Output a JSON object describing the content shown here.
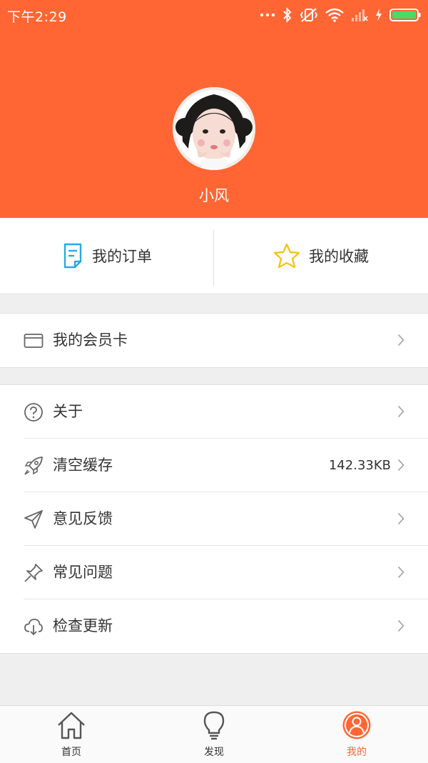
{
  "status_bar": {
    "time": "下午2:29"
  },
  "profile": {
    "username": "小风"
  },
  "quick_actions": [
    {
      "label": "我的订单",
      "icon": "order-document-icon"
    },
    {
      "label": "我的收藏",
      "icon": "star-icon"
    }
  ],
  "member": {
    "label": "我的会员卡",
    "icon": "card-icon"
  },
  "settings": [
    {
      "label": "关于",
      "icon": "question-circle-icon"
    },
    {
      "label": "清空缓存",
      "value": "142.33KB",
      "icon": "rocket-icon"
    },
    {
      "label": "意见反馈",
      "icon": "paper-plane-icon"
    },
    {
      "label": "常见问题",
      "icon": "pin-icon"
    },
    {
      "label": "检查更新",
      "icon": "cloud-download-icon"
    }
  ],
  "tabs": [
    {
      "label": "首页",
      "icon": "home-icon"
    },
    {
      "label": "发现",
      "icon": "lightbulb-icon"
    },
    {
      "label": "我的",
      "icon": "user-icon",
      "active": true
    }
  ],
  "colors": {
    "accent": "#ff6633",
    "star": "#f5c518",
    "order_icon": "#29a9e0"
  }
}
